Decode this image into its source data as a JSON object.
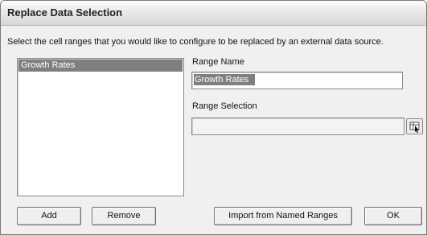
{
  "window": {
    "title": "Replace Data Selection"
  },
  "instruction": "Select the cell ranges that you would like to configure to be replaced by an external data source.",
  "ranges_list": {
    "items": [
      {
        "label": "Growth Rates",
        "selected": true
      }
    ]
  },
  "range_name": {
    "label": "Range Name",
    "value": "Growth Rates"
  },
  "range_selection": {
    "label": "Range Selection",
    "value": "",
    "picker_icon": "range-picker-icon"
  },
  "buttons": {
    "add": "Add",
    "remove": "Remove",
    "import": "Import from Named Ranges",
    "ok": "OK"
  }
}
